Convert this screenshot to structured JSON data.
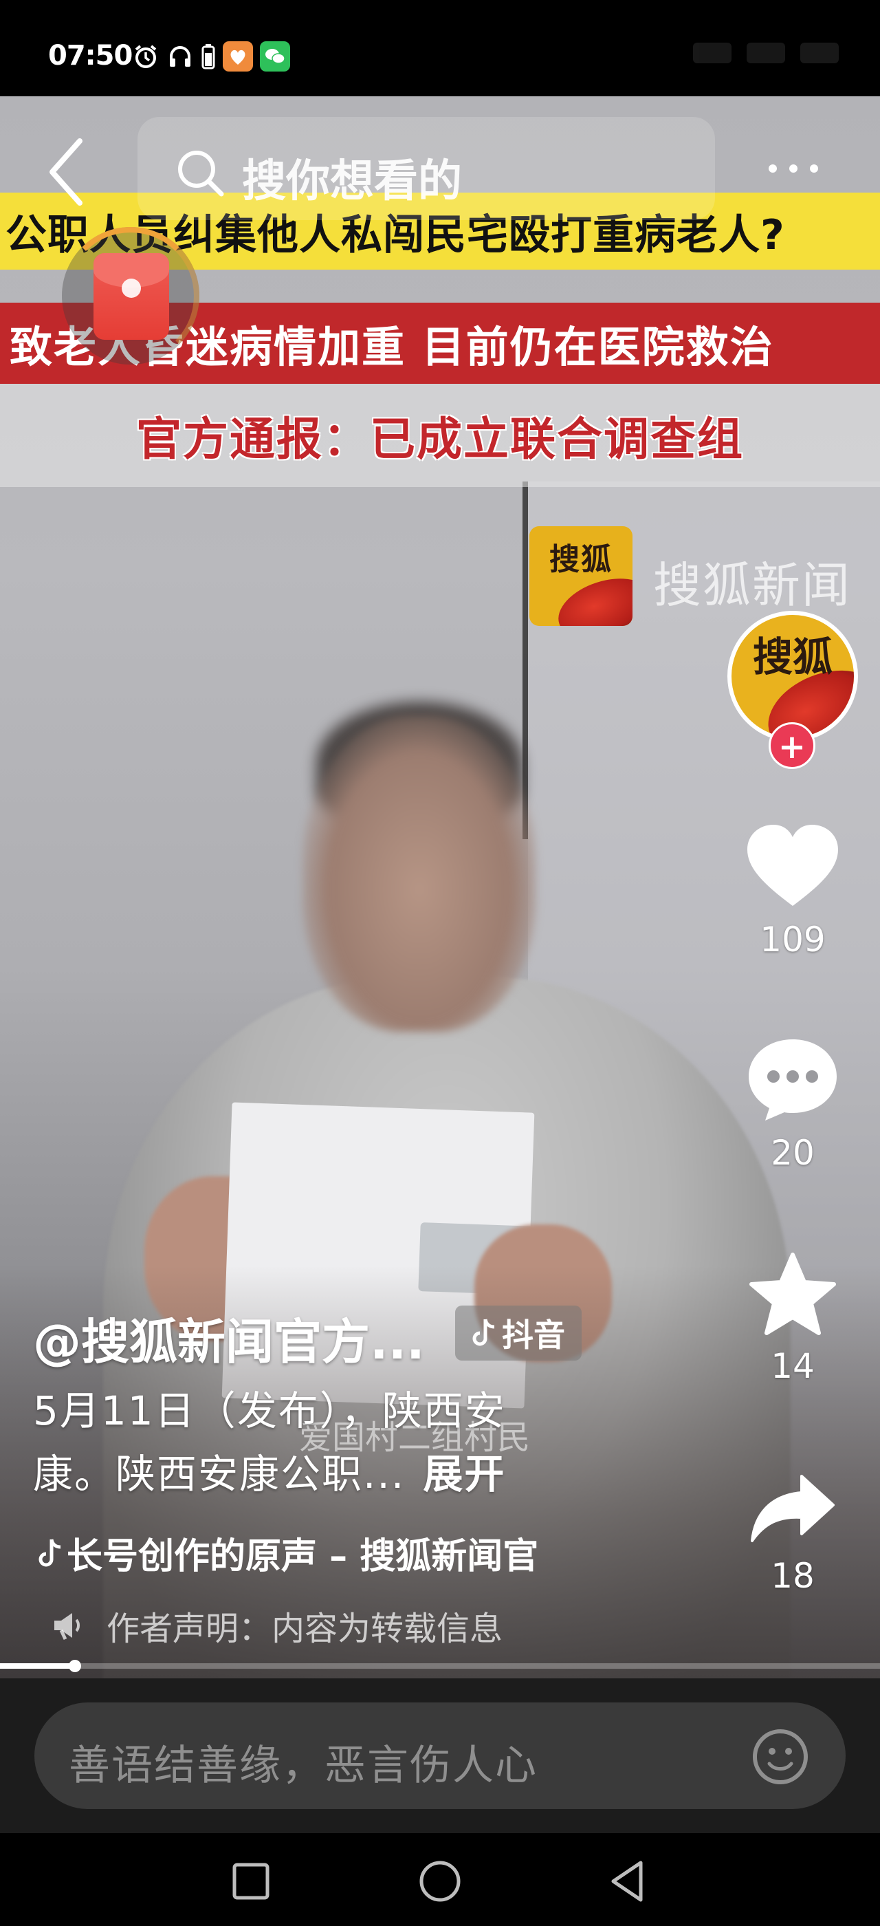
{
  "status_bar": {
    "time": "07:50",
    "icons": [
      "alarm-icon",
      "headphones-icon",
      "battery-icon",
      "orange-app-icon",
      "wechat-icon"
    ]
  },
  "top_bar": {
    "search_placeholder": "搜你想看的"
  },
  "video": {
    "headline_1": "公职人员纠集他人私闯民宅殴打重病老人?",
    "headline_2": "致老人昏迷病情加重  目前仍在医院救治",
    "headline_3": "官方通报：已成立联合调查组",
    "watermark_logo": "搜狐",
    "watermark_text": "搜狐新闻",
    "subtitle": "爱国村二组村民"
  },
  "side_actions": {
    "avatar_text": "搜狐",
    "likes": "109",
    "comments": "20",
    "favorites": "14",
    "shares": "18"
  },
  "post": {
    "author": "@搜狐新闻官方...",
    "platform_tag": "抖音",
    "description_line_1": "5月11日（发布），陕西安",
    "description_line_2": "康。陕西安康公职...",
    "expand_label": "展开",
    "music": "长号创作的原声 – 搜狐新闻官",
    "notice": "作者声明：内容为转载信息",
    "progress": 0.085
  },
  "comment_bar": {
    "placeholder": "善语结善缘，恶言伤人心"
  },
  "colors": {
    "like_white": "#ffffff",
    "banner_yellow": "#f5df3a",
    "banner_red": "#c0282b",
    "follow_pink": "#ea3a55"
  }
}
